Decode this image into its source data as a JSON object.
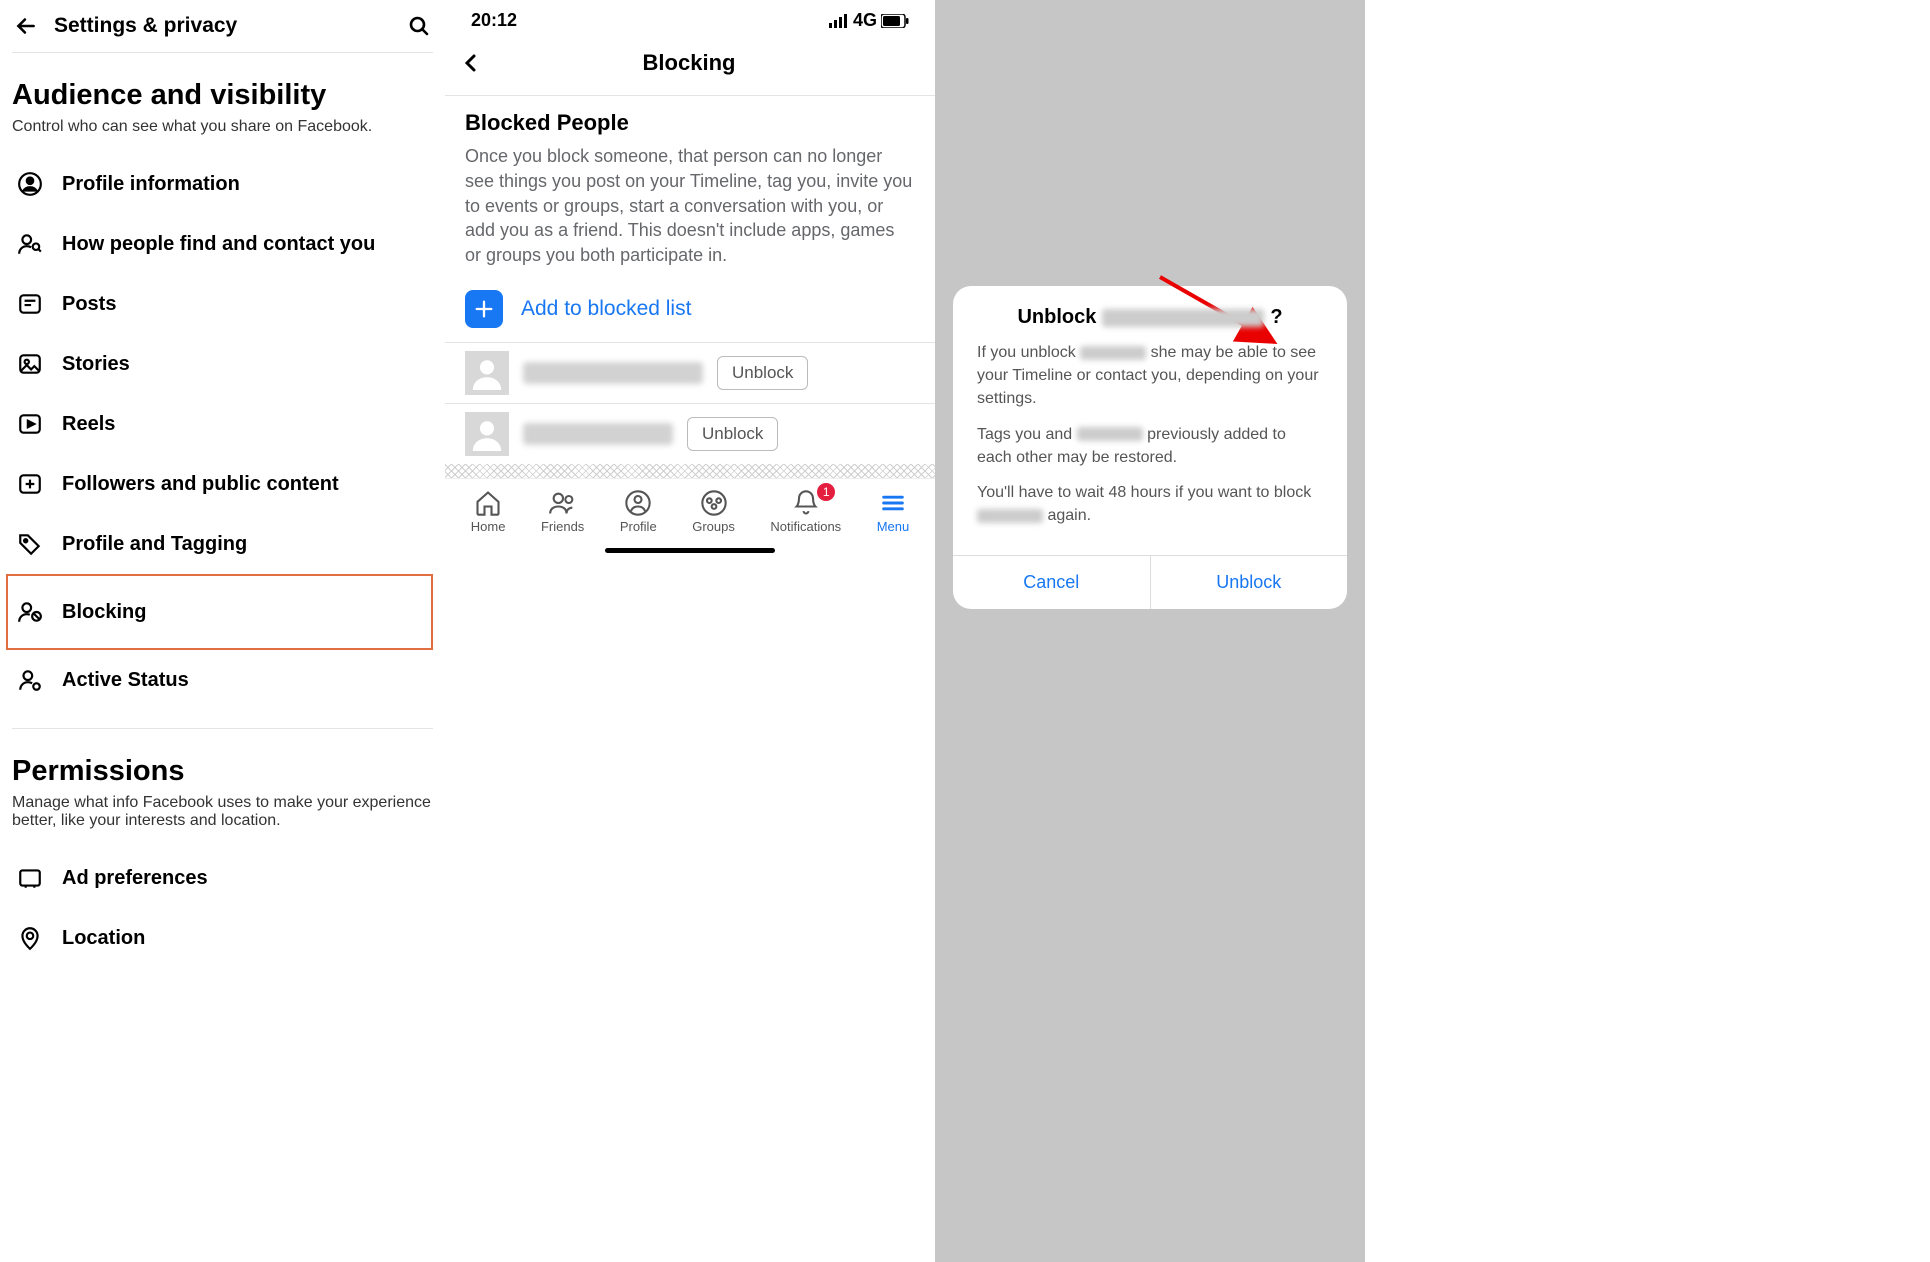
{
  "panel1": {
    "header": "Settings & privacy",
    "section1": {
      "title": "Audience and visibility",
      "sub": "Control who can see what you share on Facebook.",
      "items": [
        {
          "label": "Profile information"
        },
        {
          "label": "How people find and contact you"
        },
        {
          "label": "Posts"
        },
        {
          "label": "Stories"
        },
        {
          "label": "Reels"
        },
        {
          "label": "Followers and public content"
        },
        {
          "label": "Profile and Tagging"
        },
        {
          "label": "Blocking"
        },
        {
          "label": "Active Status"
        }
      ]
    },
    "section2": {
      "title": "Permissions",
      "sub": "Manage what info Facebook uses to make your experience better, like your interests and location.",
      "items": [
        {
          "label": "Ad preferences"
        },
        {
          "label": "Location"
        }
      ]
    }
  },
  "panel2": {
    "time": "20:12",
    "network": "4G",
    "title": "Blocking",
    "bpTitle": "Blocked People",
    "bpDesc": "Once you block someone, that person can no longer see things you post on your Timeline, tag you, invite you to events or groups, start a conversation with you, or add you as a friend. This doesn't include apps, games or groups you both participate in.",
    "addText": "Add to blocked list",
    "unblock": "Unblock",
    "nav": {
      "home": "Home",
      "friends": "Friends",
      "profile": "Profile",
      "groups": "Groups",
      "notifications": "Notifications",
      "menu": "Menu",
      "badge": "1"
    }
  },
  "panel3": {
    "titlePrefix": "Unblock",
    "titleSuffix": "?",
    "l1a": "If you unblock",
    "l1b": "she may be able to see your Timeline or contact you, depending on your settings.",
    "l2a": "Tags you and",
    "l2b": "previously added to each other may be restored.",
    "l3a": "You'll have to wait 48 hours if you want to block",
    "l3b": "again.",
    "cancel": "Cancel",
    "unblock": "Unblock"
  }
}
